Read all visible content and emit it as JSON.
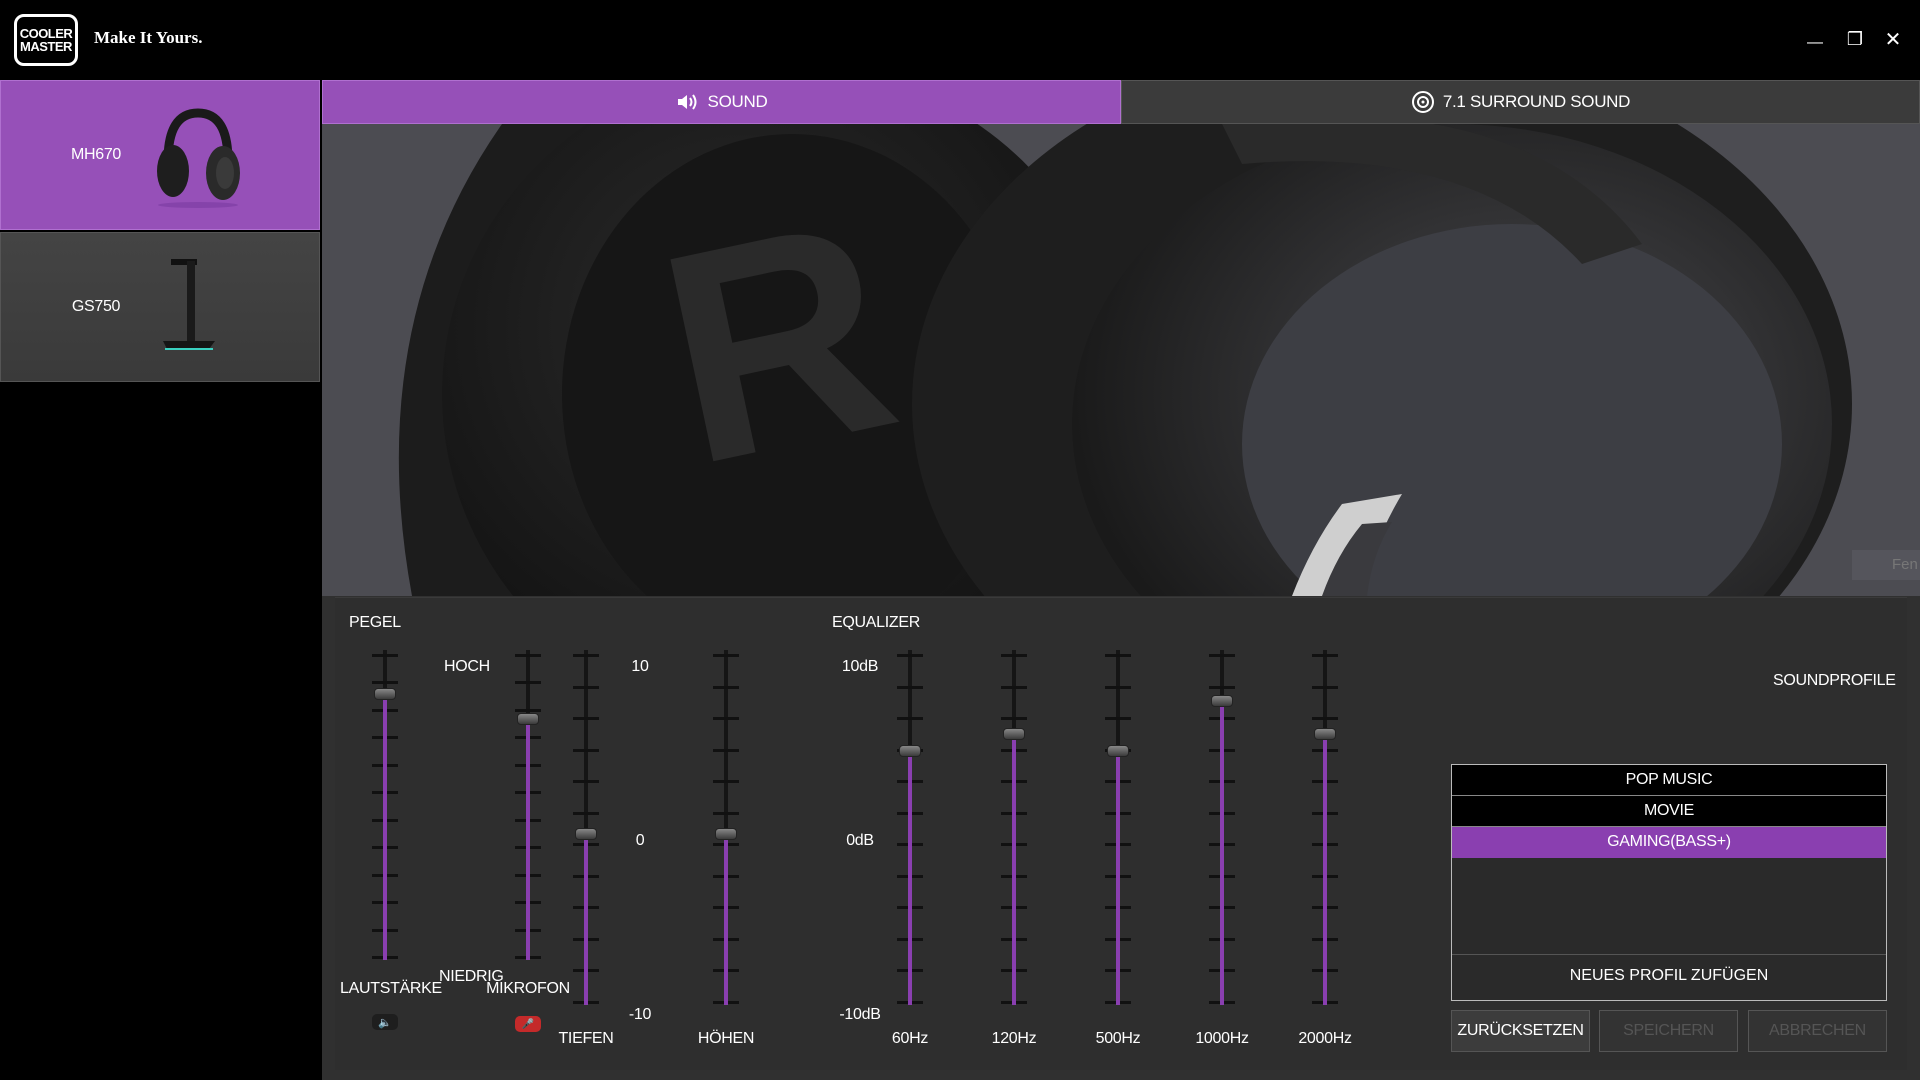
{
  "app": {
    "logo_lines": [
      "COOLER",
      "MASTER"
    ],
    "tagline": "Make It Yours."
  },
  "window_controls": {
    "minimize": "—",
    "restore": "❐",
    "close": "✕"
  },
  "sidebar": {
    "devices": [
      {
        "label": "MH670",
        "selected": true,
        "icon": "headset-icon"
      },
      {
        "label": "GS750",
        "selected": false,
        "icon": "headset-stand-icon"
      }
    ]
  },
  "tabs": [
    {
      "label": "SOUND",
      "active": true,
      "icon": "speaker-icon"
    },
    {
      "label": "7.1 SURROUND SOUND",
      "active": false,
      "icon": "surround-icon"
    }
  ],
  "hero": {
    "hidden_button_text": "Fen"
  },
  "pegel": {
    "title": "PEGEL",
    "hoch": "HOCH",
    "niedrig": "NIEDRIG",
    "volume_label": "LAUTSTÄRKE",
    "volume_level": 0.91,
    "mic_label": "MIKROFON",
    "mic_level": 0.82,
    "mic_muted": true
  },
  "tone": {
    "scale_top": "10",
    "scale_mid": "0",
    "scale_bottom": "-10",
    "bass_label": "TIEFEN",
    "bass_value": 0,
    "treble_label": "HÖHEN",
    "treble_value": 0
  },
  "equalizer": {
    "title": "EQUALIZER",
    "scale_top": "10dB",
    "scale_mid": "0dB",
    "scale_bottom": "-10dB",
    "bands": [
      {
        "label": "60Hz",
        "value": 5
      },
      {
        "label": "120Hz",
        "value": 6
      },
      {
        "label": "500Hz",
        "value": 5
      },
      {
        "label": "1000Hz",
        "value": 8
      },
      {
        "label": "2000Hz",
        "value": 6
      }
    ]
  },
  "soundprofiles": {
    "title": "SOUNDPROFILE",
    "items": [
      {
        "label": "POP MUSIC",
        "selected": false
      },
      {
        "label": "MOVIE",
        "selected": false
      },
      {
        "label": "GAMING(BASS+)",
        "selected": true
      }
    ],
    "add_label": "NEUES PROFIL ZUFÜGEN"
  },
  "actions": {
    "reset": "ZURÜCKSETZEN",
    "save": "SPEICHERN",
    "cancel": "ABBRECHEN"
  },
  "colors": {
    "accent": "#9650b8",
    "fill": "#8a3fb0",
    "mic_muted": "#c42a2a"
  }
}
